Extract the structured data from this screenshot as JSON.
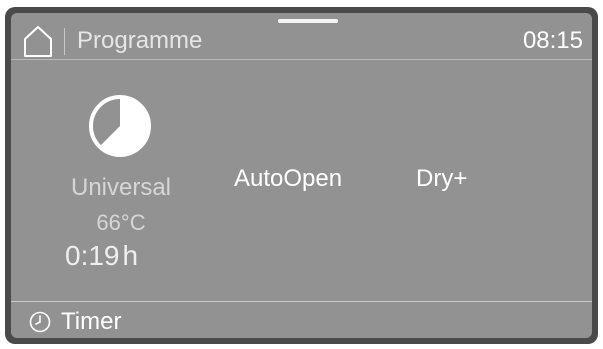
{
  "header": {
    "title": "Programme",
    "clock": "08:15",
    "home_icon": "home-icon"
  },
  "programme": {
    "icon": "pie-chart-icon",
    "name": "Universal",
    "temperature": "66°C",
    "duration_value": "0:19",
    "duration_unit": "h"
  },
  "options": {
    "autoopen": "AutoOpen",
    "dry_plus": "Dry+"
  },
  "footer": {
    "timer_icon": "clock-icon",
    "timer_label": "Timer"
  },
  "colors": {
    "screen": "#929292",
    "bezel": "#4a4a4a",
    "text": "#ffffff",
    "text_dim": "#d6d6d6"
  }
}
